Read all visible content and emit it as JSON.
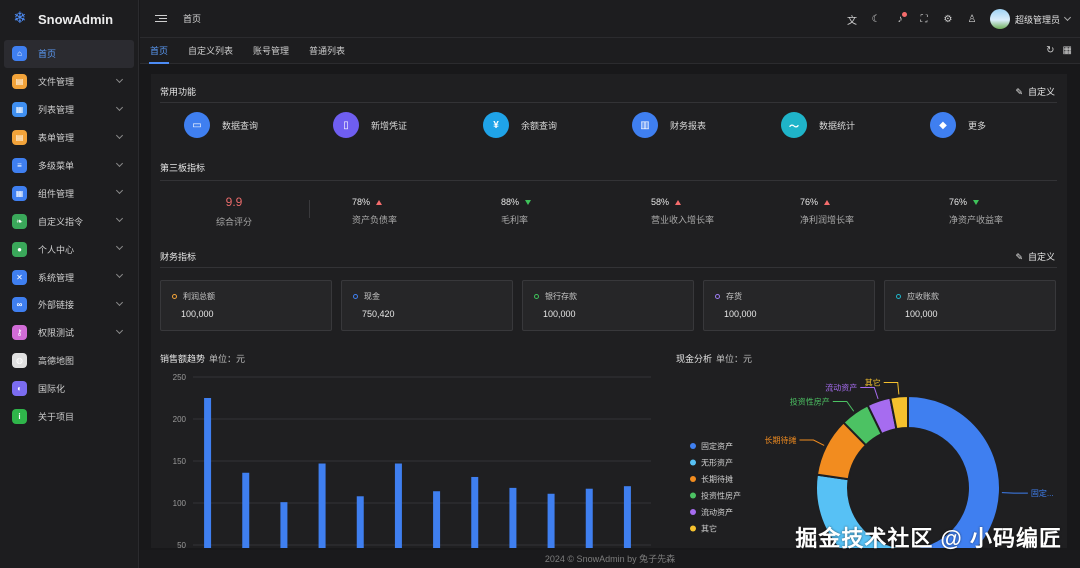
{
  "brand": {
    "name": "SnowAdmin"
  },
  "sidebar": {
    "items": [
      {
        "label": "首页",
        "icon": "home-icon",
        "color": "#3f7ff0",
        "glyph": "⌂",
        "chevron": false,
        "active": true
      },
      {
        "label": "文件管理",
        "icon": "folder-icon",
        "color": "#f2a33a",
        "glyph": "▤",
        "chevron": true,
        "active": false
      },
      {
        "label": "列表管理",
        "icon": "list-icon",
        "color": "#3f8ff0",
        "glyph": "▦",
        "chevron": true,
        "active": false
      },
      {
        "label": "表单管理",
        "icon": "form-icon",
        "color": "#f2a33a",
        "glyph": "▤",
        "chevron": true,
        "active": false
      },
      {
        "label": "多级菜单",
        "icon": "menu-icon",
        "color": "#3f7ff0",
        "glyph": "≡",
        "chevron": true,
        "active": false
      },
      {
        "label": "组件管理",
        "icon": "component-icon",
        "color": "#3f7ff0",
        "glyph": "▦",
        "chevron": true,
        "active": false
      },
      {
        "label": "自定义指令",
        "icon": "leaf-icon",
        "color": "#3aa85a",
        "glyph": "❧",
        "chevron": true,
        "active": false
      },
      {
        "label": "个人中心",
        "icon": "user-icon",
        "color": "#3aa85a",
        "glyph": "●",
        "chevron": true,
        "active": false
      },
      {
        "label": "系统管理",
        "icon": "tools-icon",
        "color": "#3f7ff0",
        "glyph": "✕",
        "chevron": true,
        "active": false
      },
      {
        "label": "外部链接",
        "icon": "link-icon",
        "color": "#3f7ff0",
        "glyph": "∞",
        "chevron": true,
        "active": false
      },
      {
        "label": "权限测试",
        "icon": "key-icon",
        "color": "#d16cd6",
        "glyph": "⚷",
        "chevron": true,
        "active": false
      },
      {
        "label": "高德地图",
        "icon": "map-icon",
        "color": "#e0e0e0",
        "glyph": "◍",
        "chevron": false,
        "active": false
      },
      {
        "label": "国际化",
        "icon": "globe-icon",
        "color": "#7b6cf0",
        "glyph": "◐",
        "chevron": false,
        "active": false
      },
      {
        "label": "关于项目",
        "icon": "info-icon",
        "color": "#2fb54a",
        "glyph": "i",
        "chevron": false,
        "active": false
      }
    ]
  },
  "header": {
    "breadcrumb": "首页",
    "user_name": "超级管理员",
    "icons": [
      {
        "name": "translate-icon",
        "glyph": "文"
      },
      {
        "name": "moon-icon",
        "glyph": "☾"
      },
      {
        "name": "bell-icon",
        "glyph": "♪"
      },
      {
        "name": "fullscreen-icon",
        "glyph": "⛶"
      },
      {
        "name": "settings-icon",
        "glyph": "⚙"
      },
      {
        "name": "shirt-icon",
        "glyph": "♙"
      }
    ]
  },
  "tabs": [
    "首页",
    "自定义列表",
    "账号管理",
    "普通列表"
  ],
  "sections": {
    "common": "常用功能",
    "third_board": "第三板指标",
    "finance": "财务指标",
    "customize": "自定义",
    "sales": "销售额趋势",
    "cash": "现金分析",
    "unit": "单位：元"
  },
  "functions": [
    {
      "label": "数据查询",
      "color": "#3f7ff0",
      "glyph": "▭"
    },
    {
      "label": "新增凭证",
      "color": "#6f5ef0",
      "glyph": "▯"
    },
    {
      "label": "余额查询",
      "color": "#1fa3e8",
      "glyph": "¥"
    },
    {
      "label": "财务报表",
      "color": "#3f7ff0",
      "glyph": "▥"
    },
    {
      "label": "数据统计",
      "color": "#1fb4c9",
      "glyph": "〜"
    },
    {
      "label": "更多",
      "color": "#3f7ff0",
      "glyph": "◆"
    }
  ],
  "score": {
    "value": "9.9",
    "label": "综合评分"
  },
  "indicators": [
    {
      "value": "78%",
      "trend": "up",
      "label": "资产负债率"
    },
    {
      "value": "88%",
      "trend": "down",
      "label": "毛利率"
    },
    {
      "value": "58%",
      "trend": "up",
      "label": "营业收入增长率"
    },
    {
      "value": "76%",
      "trend": "up",
      "label": "净利润增长率"
    },
    {
      "value": "76%",
      "trend": "down",
      "label": "净资产收益率"
    }
  ],
  "finance_cards": [
    {
      "label": "利润总额",
      "value": "100,000",
      "color": "#f2a33a"
    },
    {
      "label": "现金",
      "value": "750,420",
      "color": "#3f7ff0"
    },
    {
      "label": "银行存款",
      "value": "100,000",
      "color": "#3ec25a"
    },
    {
      "label": "存货",
      "value": "100,000",
      "color": "#9b7cf0"
    },
    {
      "label": "应收账款",
      "value": "100,000",
      "color": "#1fb4c9"
    }
  ],
  "chart_data": [
    {
      "type": "bar",
      "title": "销售额趋势",
      "ylim": [
        0,
        250
      ],
      "yticks": [
        50,
        100,
        150,
        200,
        250
      ],
      "values": [
        225,
        136,
        101,
        147,
        108,
        147,
        114,
        131,
        118,
        111,
        117,
        120
      ],
      "color": "#3f7ff0",
      "grid": true
    },
    {
      "type": "pie",
      "title": "现金分析",
      "legend": [
        "固定资产",
        "无形资产",
        "长期待摊",
        "投资性房产",
        "流动资产",
        "其它"
      ],
      "colors": [
        "#3f7ff0",
        "#57c1f5",
        "#f28c1f",
        "#4cc263",
        "#a66cf0",
        "#f5c12e"
      ],
      "values": [
        50,
        25,
        10,
        5,
        4,
        3
      ],
      "slice_labels": [
        "固定...",
        "",
        "长期待摊",
        "投资性房产",
        "流动资产",
        "其它"
      ],
      "legend_position": "left"
    }
  ],
  "footer": "2024 © SnowAdmin by 兔子先森",
  "watermark": "掘金技术社区 @ 小码编匠"
}
